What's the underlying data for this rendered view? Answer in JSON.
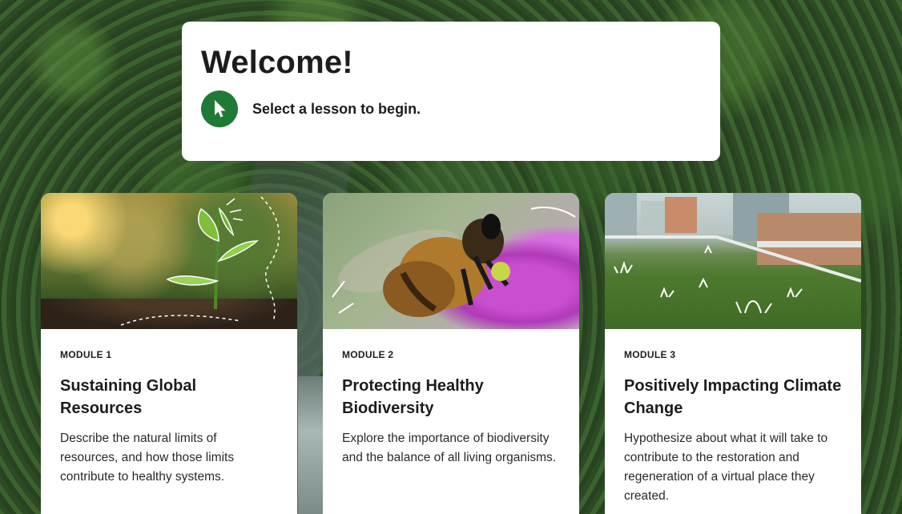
{
  "welcome": {
    "title": "Welcome!",
    "instruction": "Select a lesson to begin.",
    "icon": "cursor-pointer-icon",
    "accent_color": "#1f7a35"
  },
  "modules": [
    {
      "label": "MODULE 1",
      "title": "Sustaining Global Resources",
      "description": "Describe the natural limits of resources, and how those limits contribute to healthy systems.",
      "image": "sprout-in-soil-image"
    },
    {
      "label": "MODULE 2",
      "title": "Protecting Healthy Biodiversity",
      "description": "Explore the importance of biodiversity and the balance of all living organisms.",
      "image": "bee-on-flower-image"
    },
    {
      "label": "MODULE 3",
      "title": "Positively Impacting Climate Change",
      "description": "Hypothesize about what it will take to contribute to the restoration and regeneration of a virtual place they created.",
      "image": "green-roof-city-image"
    }
  ]
}
